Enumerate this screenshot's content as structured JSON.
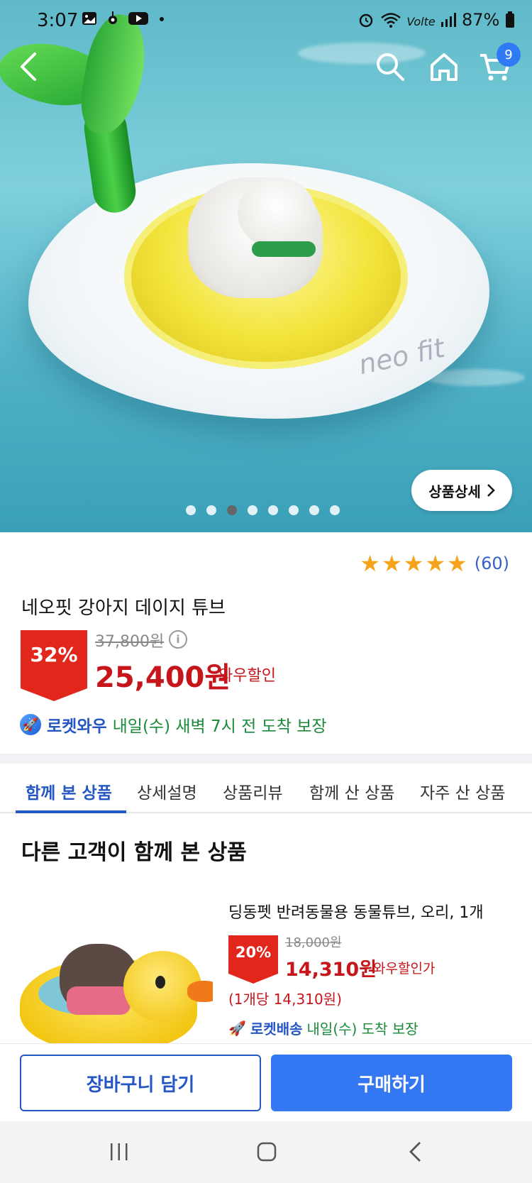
{
  "status_bar": {
    "time": "3:07",
    "battery": "87%",
    "network": "Volte"
  },
  "top_nav": {
    "cart_count": "9"
  },
  "hero": {
    "watermark": "neo fit",
    "detail_button": "상품상세",
    "pager_total": 8,
    "pager_active": 3
  },
  "product": {
    "rating_stars": 5,
    "rating_count": "(60)",
    "title": "네오핏 강아지 데이지 튜브",
    "discount": "32%",
    "original_price": "37,800원",
    "sale_price": "25,400원",
    "sale_label": "와우할인",
    "delivery_brand": "로켓와우",
    "delivery_text": "내일(수) 새벽 7시 전 도착 보장"
  },
  "tabs": [
    {
      "label": "함께 본 상품",
      "active": true
    },
    {
      "label": "상세설명",
      "active": false
    },
    {
      "label": "상품리뷰",
      "active": false
    },
    {
      "label": "함께 산 상품",
      "active": false
    },
    {
      "label": "자주 산 상품",
      "active": false
    }
  ],
  "section": {
    "title": "다른 고객이 함께 본 상품"
  },
  "related_product": {
    "name": "딩동펫 반려동물용 동물튜브, 오리, 1개",
    "discount": "20%",
    "original_price": "18,000원",
    "sale_price": "14,310원",
    "sale_label": "와우할인가",
    "unit_price": "(1개당 14,310원)",
    "delivery_brand": "로켓배송",
    "delivery_text": "내일(수) 도착 보장"
  },
  "actions": {
    "cart": "장바구니 담기",
    "buy": "구매하기"
  },
  "colors": {
    "accent_blue": "#2456c4",
    "buy_blue": "#3377f2",
    "sale_red": "#c6161b",
    "badge_red": "#e1261c",
    "star": "#f5a31a",
    "delivery_green": "#1a8a3a"
  }
}
